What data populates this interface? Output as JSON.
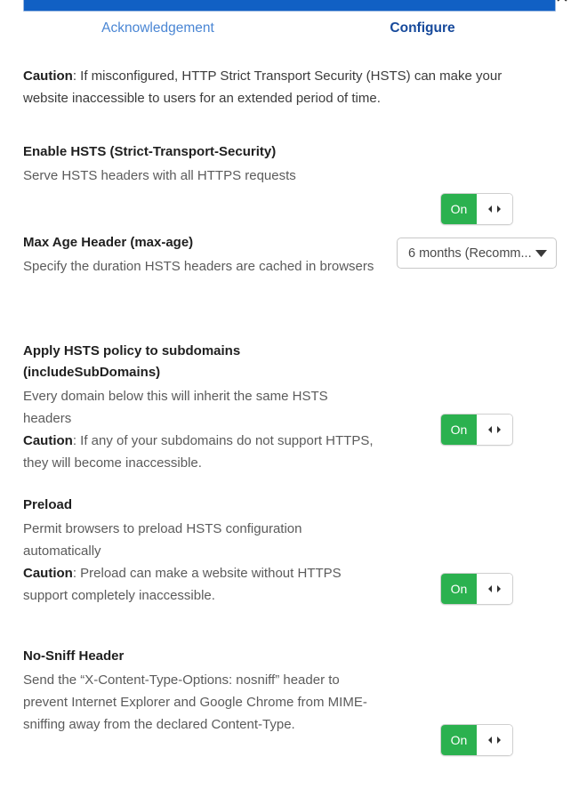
{
  "dialog": {
    "close_label": "✕",
    "progress_percent": 100
  },
  "steps": [
    {
      "label": "Acknowledgement",
      "state": "done"
    },
    {
      "label": "Configure",
      "state": "active"
    }
  ],
  "intro": {
    "strong": "Caution",
    "rest": ": If misconfigured, HTTP Strict Transport Security (HSTS) can make your website inaccessible to users for an extended period of time."
  },
  "sections": {
    "enable_hsts": {
      "title": "Enable HSTS (Strict-Transport-Security)",
      "desc": "Serve HSTS headers with all HTTPS requests",
      "toggle_label": "On"
    },
    "max_age": {
      "title": "Max Age Header (max-age)",
      "desc": "Specify the duration HSTS headers are cached in browsers",
      "select_value": "6 months (Recomm..."
    },
    "subdomains": {
      "title": "Apply HSTS policy to subdomains (includeSubDomains)",
      "desc": "Every domain below this will inherit the same HSTS headers",
      "caution_strong": "Caution",
      "caution_rest": ": If any of your subdomains do not support HTTPS, they will become inaccessible.",
      "toggle_label": "On"
    },
    "preload": {
      "title": "Preload",
      "desc": "Permit browsers to preload HSTS configuration automatically",
      "caution_strong": "Caution",
      "caution_rest": ": Preload can make a website without HTTPS support completely inaccessible.",
      "toggle_label": "On"
    },
    "no_sniff": {
      "title": "No-Sniff Header",
      "desc": "Send the “X-Content-Type-Options: nosniff” header to prevent Internet Explorer and Google Chrome from MIME-sniffing away from the declared Content-Type.",
      "toggle_label": "On"
    }
  },
  "colors": {
    "progress": "#1160c4",
    "toggle_on": "#2bb14f",
    "active_step": "#16499b",
    "done_step": "#4a86d4"
  }
}
